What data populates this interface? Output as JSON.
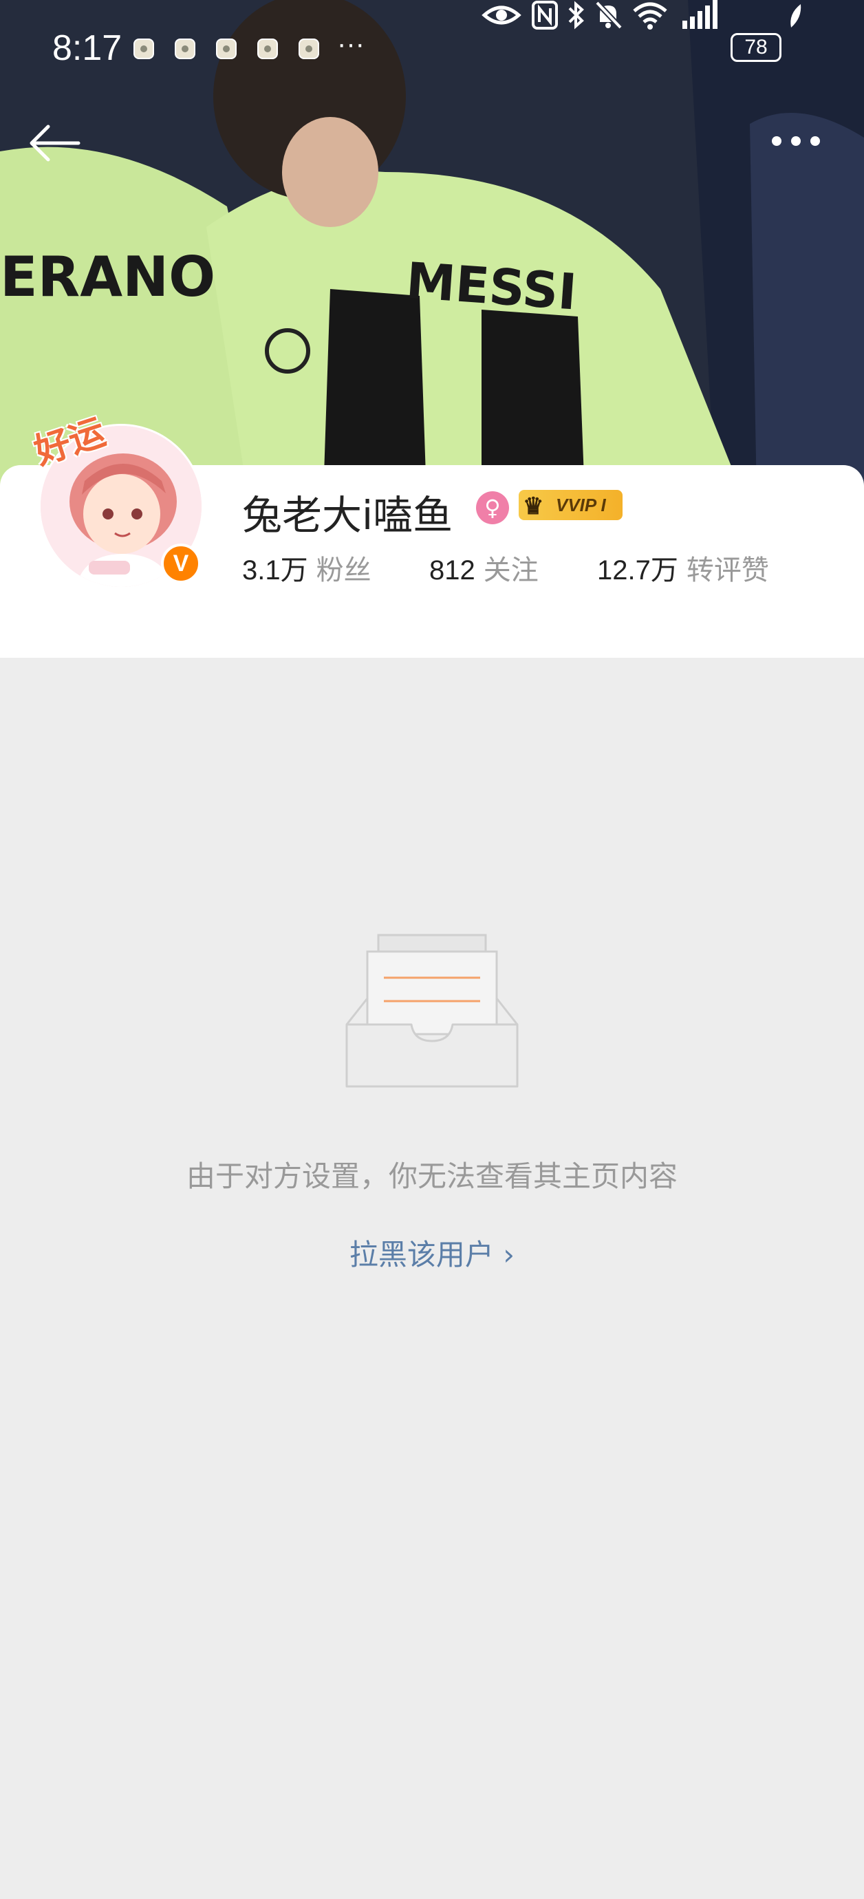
{
  "status_bar": {
    "time": "8:17",
    "more_glyph": "···",
    "battery": "78"
  },
  "header": {
    "back_icon": "arrow-left-icon",
    "more_icon": "more-dots-icon"
  },
  "banner": {
    "jersey_text_left": "ERANO",
    "jersey_text_main": "MESSI"
  },
  "profile": {
    "avatar_tag": "好运",
    "verified_badge": "V",
    "username": "兔老大i嗑鱼",
    "gender_icon": "female-icon",
    "vip_label": "VVIP I",
    "stats": [
      {
        "value": "3.1万",
        "label": "粉丝"
      },
      {
        "value": "812",
        "label": "关注"
      },
      {
        "value": "12.7万",
        "label": "转评赞"
      }
    ]
  },
  "empty_state": {
    "icon": "empty-box-icon",
    "message": "由于对方设置，你无法查看其主页内容",
    "action_label": "拉黑该用户 ›"
  },
  "colors": {
    "accent_orange": "#ff8200",
    "link_blue": "#5b7ea8",
    "background": "#ededed"
  }
}
